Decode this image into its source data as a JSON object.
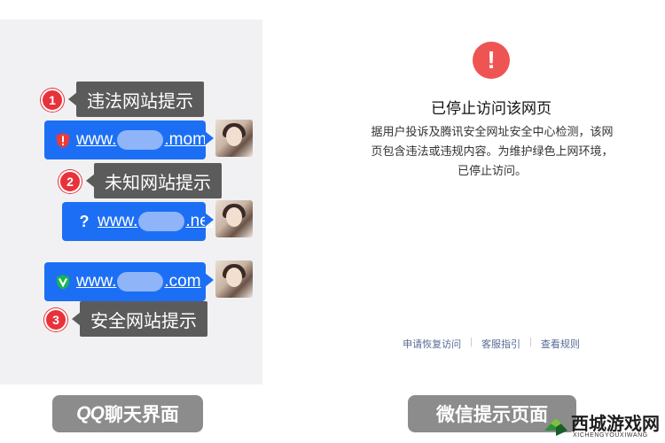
{
  "chat": {
    "messages": [
      {
        "url_prefix": "www.",
        "url_suffix": ".mom",
        "icon": "red-shield-warning-icon",
        "label": "违法网站提示",
        "number": "1"
      },
      {
        "url_prefix": "www.",
        "url_suffix": ".net",
        "icon": "question-mark-icon",
        "label": "未知网站提示",
        "number": "2"
      },
      {
        "url_prefix": "www.",
        "url_suffix": ".com",
        "icon": "green-check-v-icon",
        "label": "安全网站提示",
        "number": "3"
      }
    ],
    "caption_qq": "QQ",
    "caption_rest": "聊天界面"
  },
  "wechat": {
    "title": "已停止访问该网页",
    "body": "据用户投诉及腾讯安全网址安全中心检测，该网页包含违法或违规内容。为维护绿色上网环境，已停止访问。",
    "links": [
      "申请恢复访问",
      "客服指引",
      "查看规则"
    ],
    "caption": "微信提示页面"
  },
  "watermark": {
    "name": "西城游戏网",
    "pinyin": "XICHENGYOUXIWANG"
  },
  "colors": {
    "bubble_blue": "#1c6ff5",
    "label_gray": "#5b5b5b",
    "badge_red": "#e8323a",
    "warning_red": "#ee5552",
    "link_blue": "#576b95",
    "caption_gray": "#8c8c8c"
  }
}
